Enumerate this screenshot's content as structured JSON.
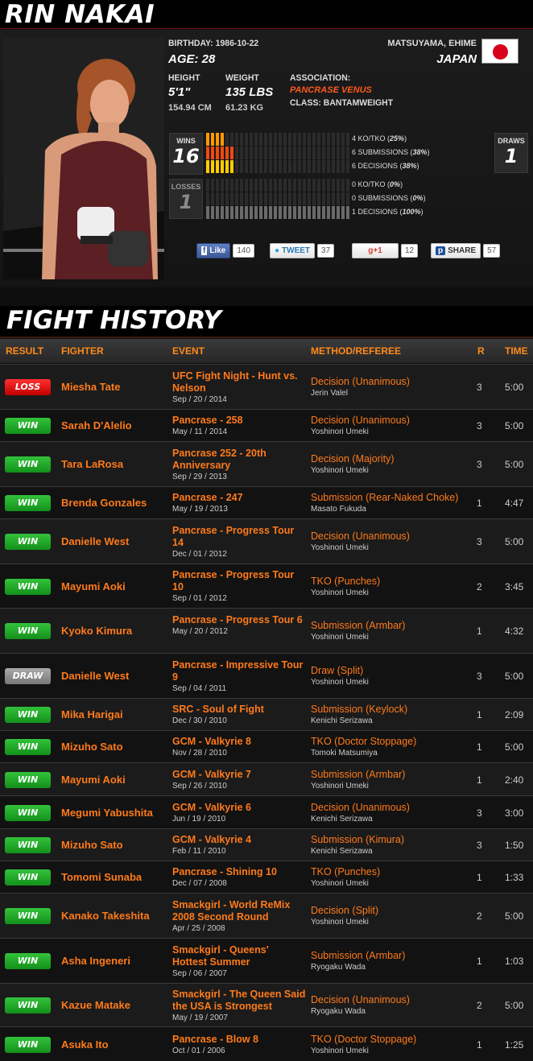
{
  "header": {
    "name": "RIN NAKAI"
  },
  "profile": {
    "birthday_label": "BIRTHDAY:",
    "birthday": "1986-10-22",
    "age": "AGE: 28",
    "hometown": "MATSUYAMA, EHIME",
    "country": "JAPAN",
    "height_label": "HEIGHT",
    "height_imperial": "5'1\"",
    "height_metric": "154.94 CM",
    "weight_label": "WEIGHT",
    "weight_imperial": "135 LBS",
    "weight_metric": "61.23 KG",
    "association_label": "ASSOCIATION:",
    "association": "PANCRASE VENUS",
    "class": "CLASS: BANTAMWEIGHT",
    "flag_icon": "japan-flag-icon"
  },
  "record": {
    "wins_label": "WINS",
    "wins": "16",
    "losses_label": "LOSSES",
    "losses": "1",
    "draws_label": "DRAWS",
    "draws": "1",
    "win_breakdown": [
      {
        "count": "4",
        "type": "KO/TKO",
        "pct": "25%"
      },
      {
        "count": "6",
        "type": "SUBMISSIONS",
        "pct": "38%"
      },
      {
        "count": "6",
        "type": "DECISIONS",
        "pct": "38%"
      }
    ],
    "loss_breakdown": [
      {
        "count": "0",
        "type": "KO/TKO",
        "pct": "0%"
      },
      {
        "count": "0",
        "type": "SUBMISSIONS",
        "pct": "0%"
      },
      {
        "count": "1",
        "type": "DECISIONS",
        "pct": "100%"
      }
    ]
  },
  "social": {
    "like_label": "Like",
    "like_count": "140",
    "tweet_label": "TWEET",
    "tweet_count": "37",
    "gplus_label": "+1",
    "gplus_count": "12",
    "share_label": "SHARE",
    "share_count": "57"
  },
  "fight_history": {
    "title": "FIGHT HISTORY",
    "columns": {
      "result": "RESULT",
      "fighter": "FIGHTER",
      "event": "EVENT",
      "method": "METHOD/REFEREE",
      "round": "R",
      "time": "TIME"
    },
    "fights": [
      {
        "result": "LOSS",
        "fighter": "Miesha Tate",
        "event": "UFC Fight Night - Hunt vs. Nelson",
        "date": "Sep / 20 / 2014",
        "method": "Decision (Unanimous)",
        "referee": "Jerin Valel",
        "round": "3",
        "time": "5:00"
      },
      {
        "result": "WIN",
        "fighter": "Sarah D'Alelio",
        "event": "Pancrase - 258",
        "date": "May / 11 / 2014",
        "method": "Decision (Unanimous)",
        "referee": "Yoshinori Umeki",
        "round": "3",
        "time": "5:00"
      },
      {
        "result": "WIN",
        "fighter": "Tara LaRosa",
        "event": "Pancrase 252 - 20th Anniversary",
        "date": "Sep / 29 / 2013",
        "method": "Decision (Majority)",
        "referee": "Yoshinori Umeki",
        "round": "3",
        "time": "5:00"
      },
      {
        "result": "WIN",
        "fighter": "Brenda Gonzales",
        "event": "Pancrase - 247",
        "date": "May / 19 / 2013",
        "method": "Submission (Rear-Naked Choke)",
        "referee": "Masato Fukuda",
        "round": "1",
        "time": "4:47"
      },
      {
        "result": "WIN",
        "fighter": "Danielle West",
        "event": "Pancrase - Progress Tour 14",
        "date": "Dec / 01 / 2012",
        "method": "Decision (Unanimous)",
        "referee": "Yoshinori Umeki",
        "round": "3",
        "time": "5:00"
      },
      {
        "result": "WIN",
        "fighter": "Mayumi Aoki",
        "event": "Pancrase - Progress Tour 10",
        "date": "Sep / 01 / 2012",
        "method": "TKO (Punches)",
        "referee": "Yoshinori Umeki",
        "round": "2",
        "time": "3:45"
      },
      {
        "result": "WIN",
        "fighter": "Kyoko Kimura",
        "event": "Pancrase - Progress Tour 6",
        "date": "May / 20 / 2012",
        "method": "Submission (Armbar)",
        "referee": "Yoshinori Umeki",
        "round": "1",
        "time": "4:32"
      },
      {
        "result": "DRAW",
        "fighter": "Danielle West",
        "event": "Pancrase - Impressive Tour 9",
        "date": "Sep / 04 / 2011",
        "method": "Draw (Split)",
        "referee": "Yoshinori Umeki",
        "round": "3",
        "time": "5:00"
      },
      {
        "result": "WIN",
        "fighter": "Mika Harigai",
        "event": "SRC - Soul of Fight",
        "date": "Dec / 30 / 2010",
        "method": "Submission (Keylock)",
        "referee": "Kenichi Serizawa",
        "round": "1",
        "time": "2:09"
      },
      {
        "result": "WIN",
        "fighter": "Mizuho Sato",
        "event": "GCM - Valkyrie 8",
        "date": "Nov / 28 / 2010",
        "method": "TKO (Doctor Stoppage)",
        "referee": "Tomoki Matsumiya",
        "round": "1",
        "time": "5:00"
      },
      {
        "result": "WIN",
        "fighter": "Mayumi Aoki",
        "event": "GCM - Valkyrie 7",
        "date": "Sep / 26 / 2010",
        "method": "Submission (Armbar)",
        "referee": "Yoshinori Umeki",
        "round": "1",
        "time": "2:40"
      },
      {
        "result": "WIN",
        "fighter": "Megumi Yabushita",
        "event": "GCM - Valkyrie 6",
        "date": "Jun / 19 / 2010",
        "method": "Decision (Unanimous)",
        "referee": "Kenichi Serizawa",
        "round": "3",
        "time": "3:00"
      },
      {
        "result": "WIN",
        "fighter": "Mizuho Sato",
        "event": "GCM - Valkyrie 4",
        "date": "Feb / 11 / 2010",
        "method": "Submission (Kimura)",
        "referee": "Kenichi Serizawa",
        "round": "3",
        "time": "1:50"
      },
      {
        "result": "WIN",
        "fighter": "Tomomi Sunaba",
        "event": "Pancrase - Shining 10",
        "date": "Dec / 07 / 2008",
        "method": "TKO (Punches)",
        "referee": "Yoshinori Umeki",
        "round": "1",
        "time": "1:33"
      },
      {
        "result": "WIN",
        "fighter": "Kanako Takeshita",
        "event": "Smackgirl - World ReMix 2008 Second Round",
        "date": "Apr / 25 / 2008",
        "method": "Decision (Split)",
        "referee": "Yoshinori Umeki",
        "round": "2",
        "time": "5:00"
      },
      {
        "result": "WIN",
        "fighter": "Asha Ingeneri",
        "event": "Smackgirl - Queens' Hottest Summer",
        "date": "Sep / 06 / 2007",
        "method": "Submission (Armbar)",
        "referee": "Ryogaku Wada",
        "round": "1",
        "time": "1:03"
      },
      {
        "result": "WIN",
        "fighter": "Kazue Matake",
        "event": "Smackgirl - The Queen Said the USA is Strongest",
        "date": "May / 19 / 2007",
        "method": "Decision (Unanimous)",
        "referee": "Ryogaku Wada",
        "round": "2",
        "time": "5:00"
      },
      {
        "result": "WIN",
        "fighter": "Asuka Ito",
        "event": "Pancrase - Blow 8",
        "date": "Oct / 01 / 2006",
        "method": "TKO (Doctor Stoppage)",
        "referee": "Yoshinori Umeki",
        "round": "1",
        "time": "1:25"
      }
    ]
  },
  "colors": {
    "accent": "#ff7a1a",
    "win": "#1fa826",
    "loss": "#e01010",
    "draw": "#8a8a8a"
  }
}
